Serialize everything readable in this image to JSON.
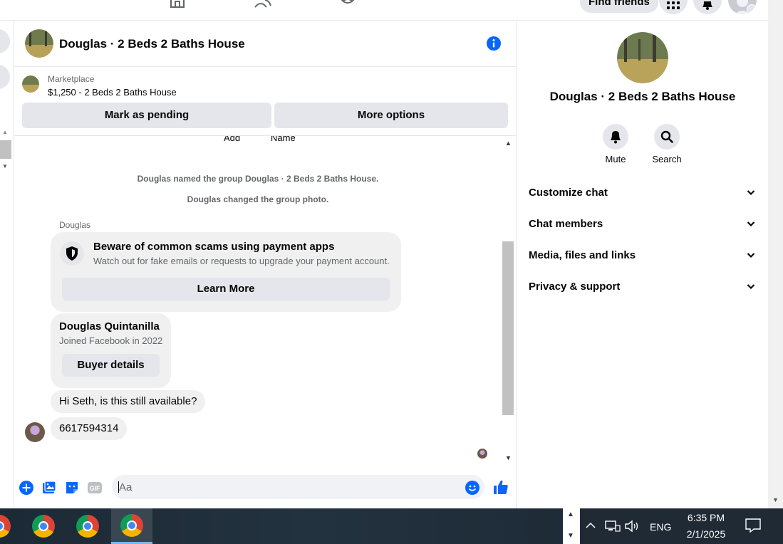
{
  "topnav": {
    "find_friends_label": "Find friends"
  },
  "chat": {
    "title": "Douglas · 2 Beds 2 Baths House",
    "marketplace": {
      "label": "Marketplace",
      "listing": "$1,250 - 2 Beds 2 Baths House"
    },
    "buttons": {
      "mark_pending": "Mark as pending",
      "more_options": "More options"
    },
    "truncated_labels": [
      "Add",
      "Name"
    ],
    "system_messages": [
      "Douglas named the group Douglas · 2 Beds 2 Baths House.",
      "Douglas changed the group photo."
    ],
    "sender_name": "Douglas",
    "scam_card": {
      "title": "Beware of common scams using payment apps",
      "subtitle": "Watch out for fake emails or requests to upgrade your payment account.",
      "button": "Learn More"
    },
    "buyer_card": {
      "name": "Douglas Quintanilla",
      "joined": "Joined Facebook in 2022",
      "button": "Buyer details"
    },
    "messages": [
      "Hi Seth, is this still available?",
      "6617594314"
    ],
    "composer": {
      "placeholder": "Aa",
      "gif_label": "GIF"
    }
  },
  "right_panel": {
    "title": "Douglas · 2 Beds 2 Baths House",
    "actions": [
      {
        "label": "Mute",
        "icon": "bell-icon"
      },
      {
        "label": "Search",
        "icon": "search-icon"
      }
    ],
    "sections": [
      "Customize chat",
      "Chat members",
      "Media, files and links",
      "Privacy & support"
    ]
  },
  "taskbar": {
    "language": "ENG",
    "time": "6:35 PM",
    "date": "2/1/2025"
  },
  "colors": {
    "accent": "#0866ff",
    "bubble": "#f0f0f0",
    "button_gray": "#e4e6eb",
    "secondary_text": "#65676b"
  }
}
